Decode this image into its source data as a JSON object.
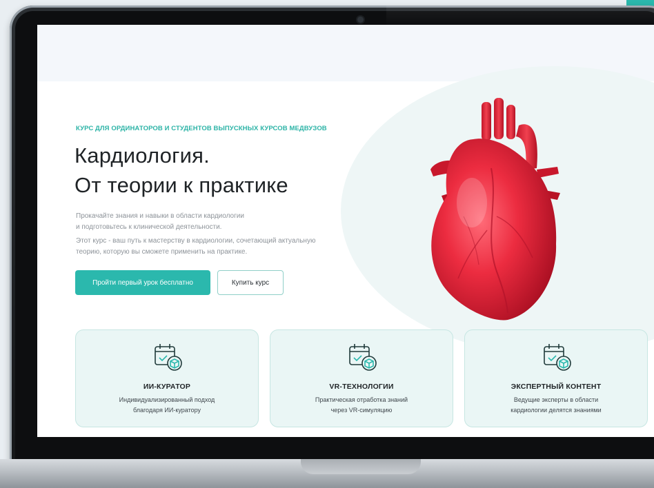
{
  "hero": {
    "kicker": "КУРС ДЛЯ ОРДИНАТОРОВ И СТУДЕНТОВ ВЫПУСКНЫХ КУРСОВ МЕДВУЗОВ",
    "title_line1": "Кардиология.",
    "title_line2": "От теории к практике",
    "desc_line1": "Прокачайте знания и навыки в области кардиологии",
    "desc_line2": "и подготовьтесь к клинической деятельности.",
    "desc_line3": "Этот курс - ваш путь к мастерству в кардиологии, сочетающий актуальную",
    "desc_line4": "теорию, которую вы сможете применить на практике.",
    "primary_button": "Пройти первый урок бесплатно",
    "secondary_button": "Купить курс",
    "image": "anatomical-heart-illustration"
  },
  "features": [
    {
      "icon": "calendar-box-icon",
      "title": "ИИ-КУРАТОР",
      "text_line1": "Индивидуализированный подход",
      "text_line2": "благодаря ИИ-куратору"
    },
    {
      "icon": "calendar-box-icon",
      "title": "VR-ТЕХНОЛОГИИ",
      "text_line1": "Практическая отработка знаний",
      "text_line2": "через VR-симуляцию"
    },
    {
      "icon": "calendar-box-icon",
      "title": "ЭКСПЕРТНЫЙ КОНТЕНТ",
      "text_line1": "Ведущие эксперты в области",
      "text_line2": "кардиологии делятся знаниями"
    }
  ],
  "colors": {
    "accent": "#2bb8ad",
    "card_bg": "#eaf6f5",
    "heart": "#e8283c"
  }
}
